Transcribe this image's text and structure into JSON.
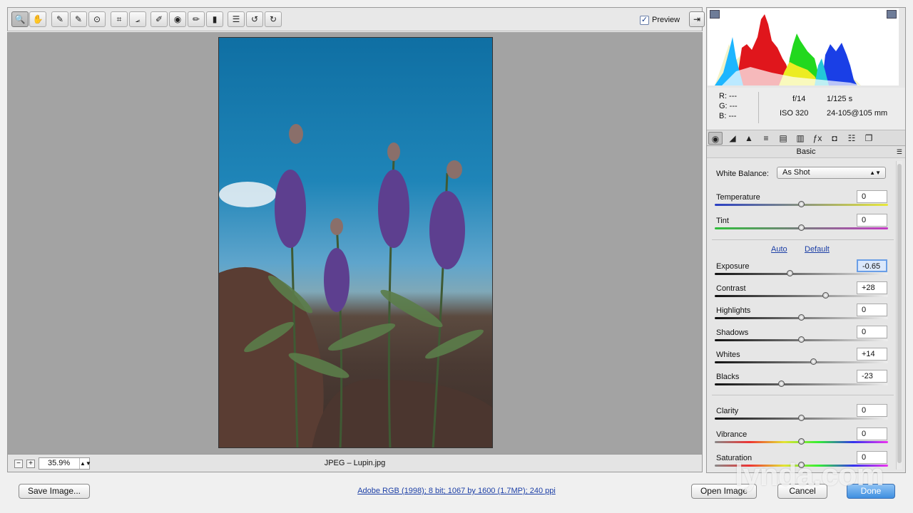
{
  "toolbar": {
    "tools": [
      {
        "name": "zoom-tool",
        "icon": "🔍",
        "active": true
      },
      {
        "name": "hand-tool",
        "icon": "✋"
      },
      {
        "name": "white-balance-tool",
        "icon": "✎"
      },
      {
        "name": "color-sampler-tool",
        "icon": "✎"
      },
      {
        "name": "targeted-adjustment-tool",
        "icon": "⊙"
      },
      {
        "name": "crop-tool",
        "icon": "⌗"
      },
      {
        "name": "straighten-tool",
        "icon": "⦟"
      },
      {
        "name": "spot-removal-tool",
        "icon": "✐"
      },
      {
        "name": "red-eye-tool",
        "icon": "◉"
      },
      {
        "name": "adjustment-brush-tool",
        "icon": "✏"
      },
      {
        "name": "graduated-filter-tool",
        "icon": "▮"
      },
      {
        "name": "preferences-tool",
        "icon": "☰"
      },
      {
        "name": "rotate-left-tool",
        "icon": "↺"
      },
      {
        "name": "rotate-right-tool",
        "icon": "↻"
      }
    ],
    "preview_label": "Preview",
    "preview_checked": "✓"
  },
  "statusbar": {
    "zoom_out": "−",
    "zoom_in": "+",
    "zoom_value": "35.9%",
    "file_info": "JPEG  –  Lupin.jpg"
  },
  "info": {
    "r": "R:  ---",
    "g": "G:  ---",
    "b": "B:  ---",
    "aperture": "f/14",
    "shutter": "1/125 s",
    "iso": "ISO 320",
    "lens": "24-105@105 mm"
  },
  "panel": {
    "section_title": "Basic",
    "white_balance_label": "White Balance:",
    "white_balance_value": "As Shot",
    "auto_link": "Auto",
    "default_link": "Default",
    "sliders": [
      {
        "label": "Temperature",
        "value": "0",
        "level": 0.5
      },
      {
        "label": "Tint",
        "value": "0",
        "level": 0.5
      },
      {
        "label": "Exposure",
        "value": "-0.65",
        "level": 0.435
      },
      {
        "label": "Contrast",
        "value": "+28",
        "level": 0.64
      },
      {
        "label": "Highlights",
        "value": "0",
        "level": 0.5
      },
      {
        "label": "Shadows",
        "value": "0",
        "level": 0.5
      },
      {
        "label": "Whites",
        "value": "+14",
        "level": 0.57
      },
      {
        "label": "Blacks",
        "value": "-23",
        "level": 0.385
      },
      {
        "label": "Clarity",
        "value": "0",
        "level": 0.5
      },
      {
        "label": "Vibrance",
        "value": "0",
        "level": 0.5
      },
      {
        "label": "Saturation",
        "value": "0",
        "level": 0.5
      }
    ]
  },
  "bottom": {
    "save_image": "Save Image...",
    "workflow_link": "Adobe RGB (1998); 8 bit; 1067 by 1600 (1.7MP); 240 ppi",
    "open_image": "Open Image",
    "cancel": "Cancel",
    "done": "Done"
  },
  "watermark": "lynda.com"
}
